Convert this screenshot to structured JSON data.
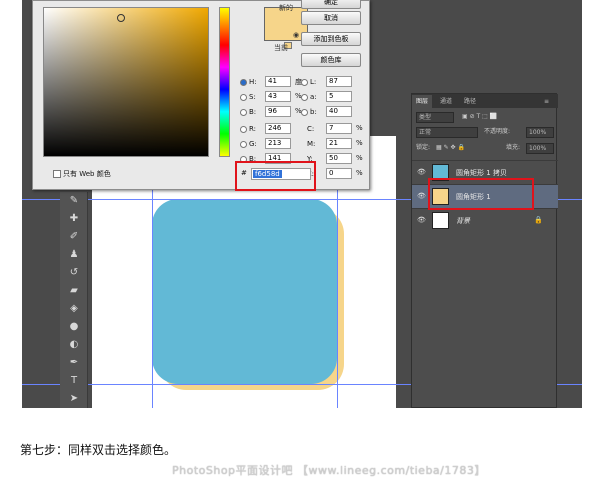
{
  "color_picker": {
    "buttons": {
      "ok": "确定",
      "cancel": "取消",
      "add_to_swatches": "添加到色板",
      "color_libraries": "颜色库"
    },
    "new_label": "新的",
    "current_label": "当前",
    "fields": {
      "H": {
        "label": "H:",
        "value": "41",
        "unit": "度"
      },
      "S": {
        "label": "S:",
        "value": "43",
        "unit": "%"
      },
      "B": {
        "label": "B:",
        "value": "96",
        "unit": "%"
      },
      "R": {
        "label": "R:",
        "value": "246"
      },
      "G": {
        "label": "G:",
        "value": "213"
      },
      "Bl": {
        "label": "B:",
        "value": "141"
      },
      "L": {
        "label": "L:",
        "value": "87"
      },
      "a": {
        "label": "a:",
        "value": "5"
      },
      "b": {
        "label": "b:",
        "value": "40"
      },
      "C": {
        "label": "C:",
        "value": "7",
        "unit": "%"
      },
      "M": {
        "label": "M:",
        "value": "21",
        "unit": "%"
      },
      "Y": {
        "label": "Y:",
        "value": "50",
        "unit": "%"
      },
      "K": {
        "label": "K:",
        "value": "0",
        "unit": "%"
      }
    },
    "hex_label": "#",
    "hex_value": "f6d58d",
    "web_only": "只有 Web 颜色",
    "selected_color": "#f6d58d"
  },
  "layers_panel": {
    "tabs": [
      "图层",
      "通道",
      "路径"
    ],
    "filter": "类型",
    "blend_mode": "正常",
    "opacity_label": "不透明度:",
    "opacity_value": "100%",
    "lock_label": "锁定:",
    "fill_label": "填充:",
    "fill_value": "100%",
    "layers": [
      {
        "name": "圆角矩形 1 拷贝",
        "thumb": "#62b9d6"
      },
      {
        "name": "圆角矩形 1",
        "thumb": "#f6d58a"
      },
      {
        "name": "背景",
        "thumb": "#ffffff"
      }
    ]
  },
  "canvas": {
    "front_shape_color": "#62b9d6",
    "back_shape_color": "#f6d58a"
  },
  "caption": "第七步：同样双击选择颜色。",
  "watermark": "PhotoShop平面设计吧 【www.lineeg.com/tieba/1783】"
}
